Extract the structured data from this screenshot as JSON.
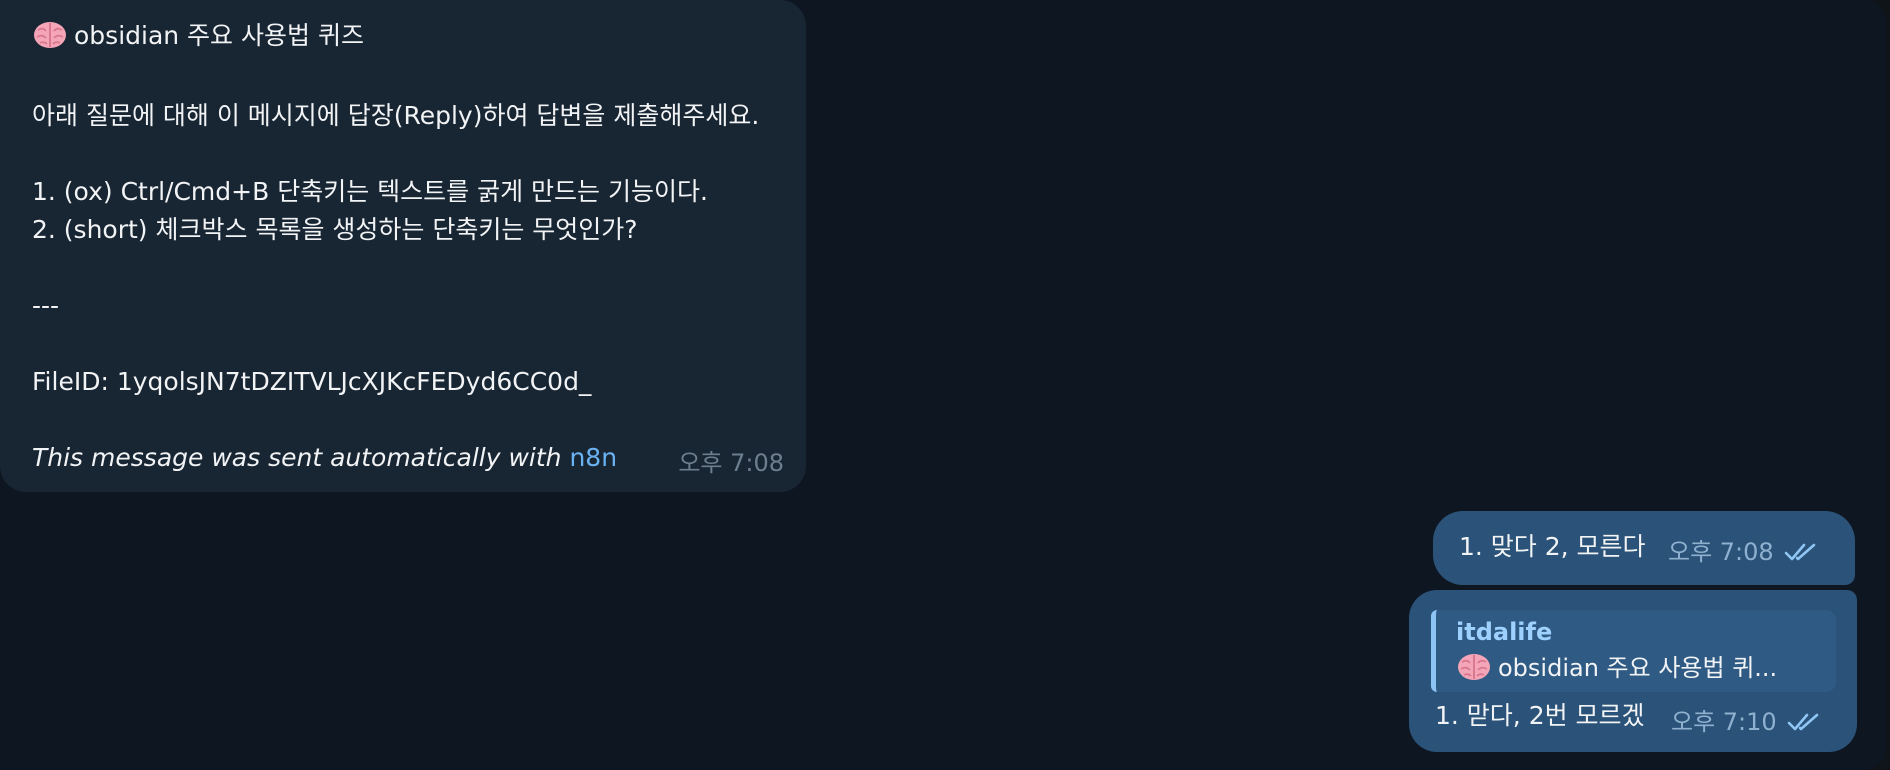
{
  "colors": {
    "background": "#0e1621",
    "incoming_bubble": "#182533",
    "outgoing_bubble": "#2b5278",
    "link": "#6ab3f3",
    "reply_author": "#9fd1ff"
  },
  "incoming_message": {
    "emoji_icon": "brain-emoji-icon",
    "title": "obsidian 주요 사용법 퀴즈",
    "instruction": "아래 질문에 대해 이 메시지에 답장(Reply)하여 답변을 제출해주세요.",
    "question_1": "1. (ox) Ctrl/Cmd+B 단축키는 텍스트를 굵게 만드는 기능이다.",
    "question_2": "2. (short) 체크박스 목록을 생성하는 단축키는 무엇인가?",
    "separator": "---",
    "file_id": "FileID: 1yqolsJN7tDZITVLJcXJKcFEDyd6CC0d_",
    "footer_text": "This message was sent automatically with",
    "footer_link": "n8n",
    "time": "오후 7:08"
  },
  "outgoing_messages": [
    {
      "text": "1. 맞다 2, 모른다",
      "time": "오후 7:08",
      "status_icon": "double-check-icon"
    },
    {
      "reply_to": {
        "author": "itdalife",
        "snippet_emoji_icon": "brain-emoji-icon",
        "snippet": "obsidian 주요 사용법 퀴..."
      },
      "text": "1. 맏다, 2번 모르겠",
      "time": "오후 7:10",
      "status_icon": "double-check-icon"
    }
  ]
}
